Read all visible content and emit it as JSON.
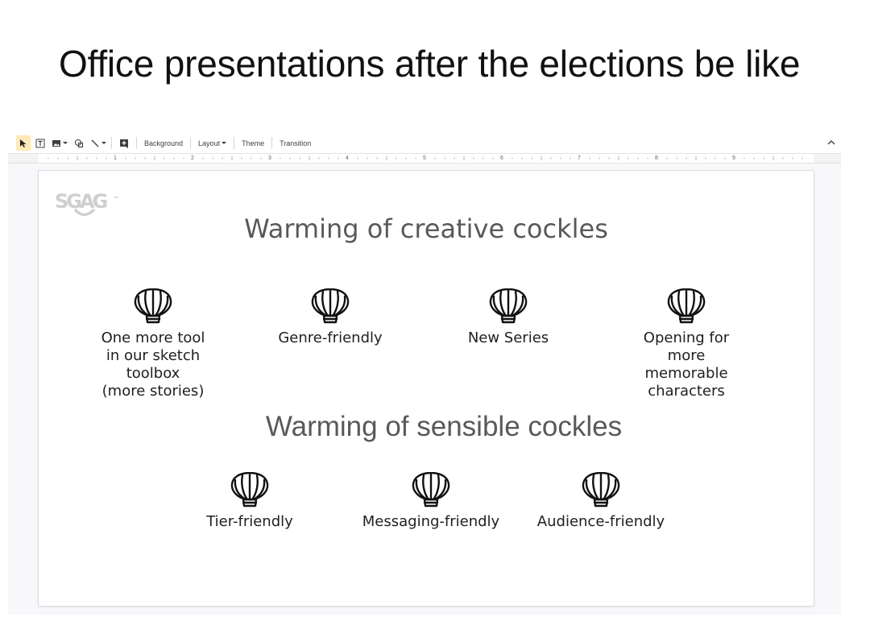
{
  "caption": "Office presentations after the elections be like",
  "toolbar": {
    "icons": [
      "cursor-icon",
      "text-box-icon",
      "image-icon",
      "shape-icon",
      "line-icon",
      "add-comment-icon"
    ],
    "background_label": "Background",
    "layout_label": "Layout",
    "theme_label": "Theme",
    "transition_label": "Transition"
  },
  "ruler": {
    "numbers": [
      "1",
      "2",
      "3",
      "4",
      "5",
      "6",
      "7",
      "8",
      "9"
    ]
  },
  "slide": {
    "logo_text": "SGAG",
    "section1": {
      "title": "Warming of creative cockles",
      "items": [
        {
          "label": "One more tool\nin our sketch\ntoolbox\n(more stories)",
          "icon": "seashell-icon"
        },
        {
          "label": "Genre-friendly",
          "icon": "seashell-icon"
        },
        {
          "label": "New Series",
          "icon": "seashell-icon"
        },
        {
          "label": "Opening for\nmore\nmemorable\ncharacters",
          "icon": "seashell-icon"
        }
      ]
    },
    "section2": {
      "title": "Warming of sensible cockles",
      "items": [
        {
          "label": "Tier-friendly",
          "icon": "seashell-icon"
        },
        {
          "label": "Messaging-friendly",
          "icon": "seashell-icon"
        },
        {
          "label": "Audience-friendly",
          "icon": "seashell-icon"
        }
      ]
    }
  },
  "colors": {
    "active_tool": "#fde9b6",
    "heading": "#595959",
    "editor_bg": "#f8f8fb"
  }
}
